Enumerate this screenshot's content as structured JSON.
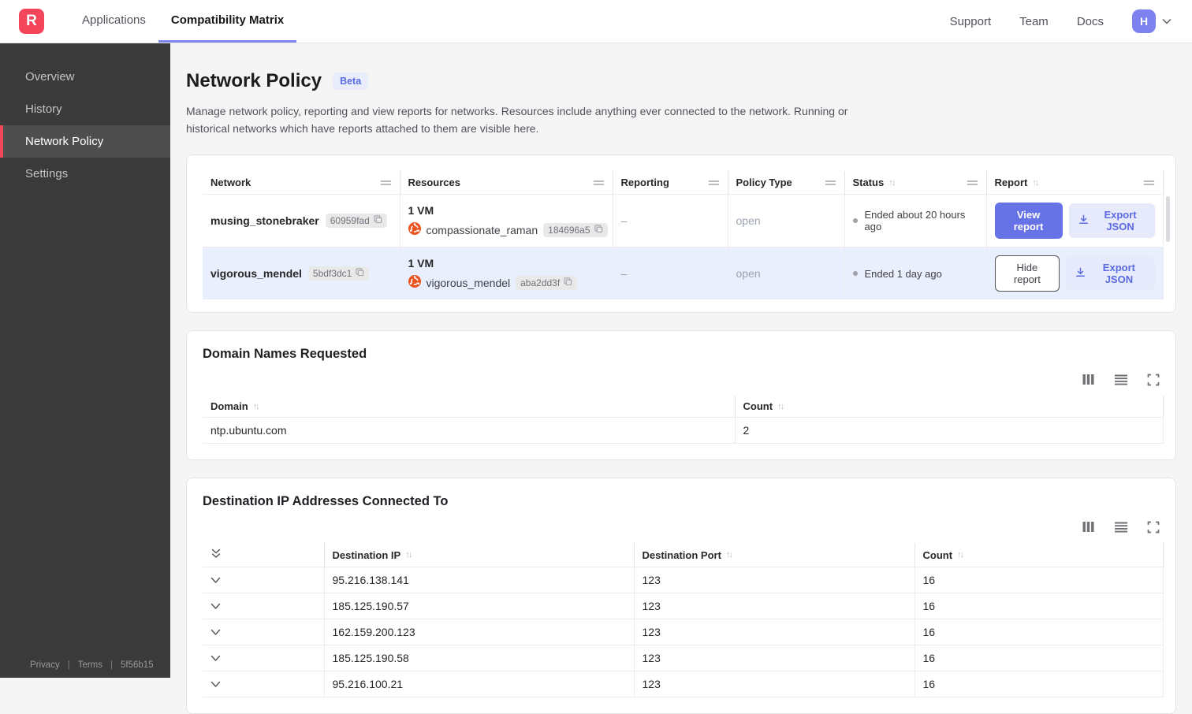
{
  "topnav": {
    "logo_letter": "R",
    "tabs": [
      {
        "label": "Applications"
      },
      {
        "label": "Compatibility Matrix"
      }
    ],
    "links": [
      "Support",
      "Team",
      "Docs"
    ],
    "avatar_initial": "H"
  },
  "sidebar": {
    "items": [
      {
        "label": "Overview"
      },
      {
        "label": "History"
      },
      {
        "label": "Network Policy"
      },
      {
        "label": "Settings"
      }
    ],
    "active_item": "Network Policy",
    "footer": {
      "privacy": "Privacy",
      "terms": "Terms",
      "build": "5f56b15"
    }
  },
  "page": {
    "title": "Network Policy",
    "badge": "Beta",
    "description": "Manage network policy, reporting and view reports for networks. Resources include anything ever connected to the network. Running or historical networks which have reports attached to them are visible here."
  },
  "networks_table": {
    "headers": {
      "network": "Network",
      "resources": "Resources",
      "reporting": "Reporting",
      "policy_type": "Policy Type",
      "status": "Status",
      "report": "Report"
    },
    "rows": [
      {
        "name": "musing_stonebraker",
        "id": "60959fad",
        "resource_summary": "1 VM",
        "vm_name": "compassionate_raman",
        "vm_id": "184696a5",
        "reporting": "–",
        "policy_type": "open",
        "status": "Ended about 20 hours ago",
        "report_action": "View report",
        "export_label": "Export JSON"
      },
      {
        "name": "vigorous_mendel",
        "id": "5bdf3dc1",
        "resource_summary": "1 VM",
        "vm_name": "vigorous_mendel",
        "vm_id": "aba2dd3f",
        "reporting": "–",
        "policy_type": "open",
        "status": "Ended 1 day ago",
        "report_action": "Hide report",
        "export_label": "Export JSON"
      }
    ]
  },
  "domains_card": {
    "title": "Domain Names Requested",
    "headers": {
      "domain": "Domain",
      "count": "Count"
    },
    "rows": [
      {
        "domain": "ntp.ubuntu.com",
        "count": "2"
      }
    ]
  },
  "destinations_card": {
    "title": "Destination IP Addresses Connected To",
    "headers": {
      "ip": "Destination IP",
      "port": "Destination Port",
      "count": "Count"
    },
    "rows": [
      {
        "ip": "95.216.138.141",
        "port": "123",
        "count": "16"
      },
      {
        "ip": "185.125.190.57",
        "port": "123",
        "count": "16"
      },
      {
        "ip": "162.159.200.123",
        "port": "123",
        "count": "16"
      },
      {
        "ip": "185.125.190.58",
        "port": "123",
        "count": "16"
      },
      {
        "ip": "95.216.100.21",
        "port": "123",
        "count": "16"
      }
    ]
  },
  "icons": {
    "logo": "app-logo-icon",
    "chevron": "chevron-down-icon",
    "expand_all": "expand-all-icon",
    "copy": "copy-icon",
    "vm": "ubuntu-logo-icon",
    "download": "download-icon",
    "sort": "sort-icon",
    "resize": "column-resize-handle-icon",
    "columns": "columns-icon",
    "density": "rows-density-icon",
    "fullscreen": "fullscreen-icon"
  },
  "colors": {
    "accent_red": "#f4465a",
    "accent_indigo": "#6673e6",
    "tab_underline": "#7b85ea",
    "avatar": "#7d82ee",
    "row_highlight": "#e9effc",
    "sidebar_bg": "#3a3a3a",
    "beta_bg": "#e9ecfb",
    "export_bg": "#e7eafb"
  }
}
